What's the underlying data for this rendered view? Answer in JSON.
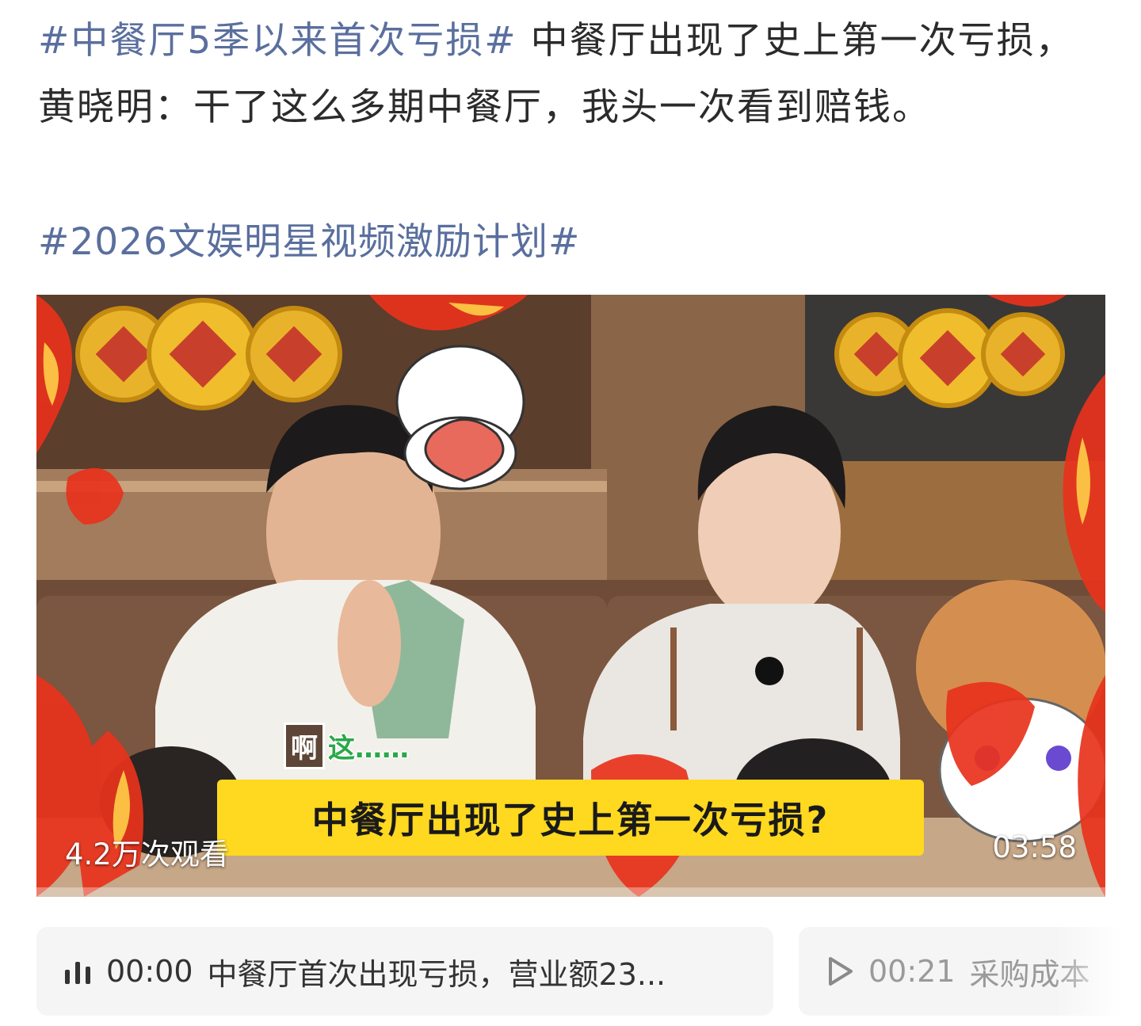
{
  "post": {
    "hashtag_main": "#中餐厅5季以来首次亏损#",
    "body": " 中餐厅出现了史上第一次亏损，黄晓明：干了这么多期中餐厅，我头一次看到赔钱。",
    "hashtag_second": "#2026文娱明星视频激励计划#"
  },
  "video": {
    "views": "4.2万次观看",
    "duration": "03:58",
    "subtitle": "中餐厅出现了史上第一次亏损?",
    "reaction_1": "啊",
    "reaction_2": "这……"
  },
  "chapters": [
    {
      "icon": "audio-bars-icon",
      "time": "00:00",
      "title": "中餐厅首次出现亏损，营业额23..."
    },
    {
      "icon": "play-icon",
      "time": "00:21",
      "title": "采购成本"
    }
  ],
  "colors": {
    "hashtag": "#5a6f9e",
    "subtitle_bg": "#ffd820",
    "chapter_bg": "#f5f5f5"
  }
}
